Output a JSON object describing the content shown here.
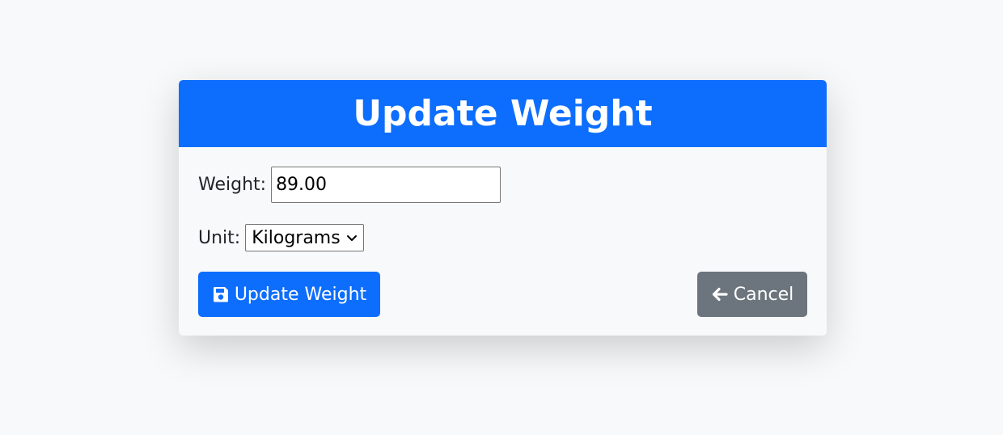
{
  "card": {
    "title": "Update Weight"
  },
  "form": {
    "weight_label": "Weight:",
    "weight_value": "89.00",
    "unit_label": "Unit:",
    "unit_selected": "Kilograms"
  },
  "buttons": {
    "update_label": "Update Weight",
    "update_icon": "floppy-disk-icon",
    "cancel_label": "Cancel",
    "cancel_icon": "arrow-left-icon"
  },
  "colors": {
    "primary": "#0d6efd",
    "secondary": "#6c757d",
    "background": "#f8f9fa"
  }
}
